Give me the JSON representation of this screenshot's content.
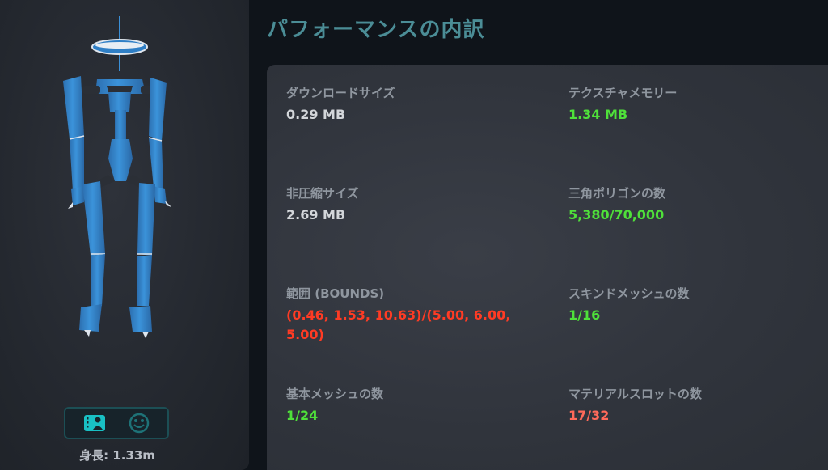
{
  "page": {
    "title": "パフォーマンスの内訳"
  },
  "preview": {
    "height_label": "身長: 1.33m",
    "toggle": [
      {
        "icon": "avatar-view-icon",
        "active": true
      },
      {
        "icon": "face-view-icon",
        "active": false
      }
    ]
  },
  "stats": {
    "download_size": {
      "label": "ダウンロードサイズ",
      "value": "0.29 MB"
    },
    "texture_memory": {
      "label": "テクスチャメモリー",
      "value": "1.34 MB"
    },
    "uncompressed_size": {
      "label": "非圧縮サイズ",
      "value": "2.69 MB"
    },
    "triangle_count": {
      "label": "三角ポリゴンの数",
      "value": "5,380/70,000"
    },
    "bounds": {
      "label": "範囲 (BOUNDS)",
      "value": "(0.46, 1.53, 10.63)/(5.00, 6.00, 5.00)"
    },
    "skinned_mesh_count": {
      "label": "スキンドメッシュの数",
      "value": "1/16"
    },
    "basic_mesh_count": {
      "label": "基本メッシュの数",
      "value": "1/24"
    },
    "material_slot_count": {
      "label": "マテリアルスロットの数",
      "value": "17/32"
    }
  },
  "colors": {
    "title": "#4b8d96",
    "ok": "#4fe03a",
    "bad": "#ff3b24",
    "warn": "#ff6a5a",
    "neutral": "#d3d6da",
    "avatar_blue": "#3b8fd6"
  }
}
